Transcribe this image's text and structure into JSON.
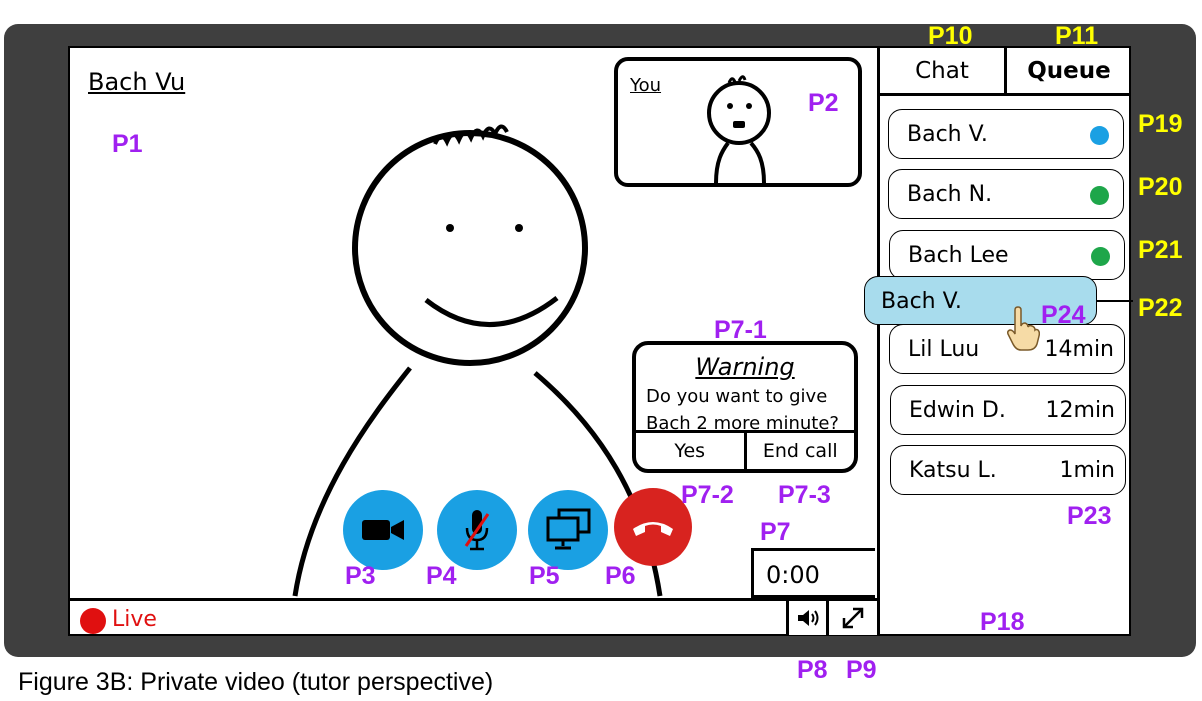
{
  "figure_caption": "Figure 3B: Private video (tutor perspective)",
  "video": {
    "tutor_name": "Bach Vu",
    "self_view_label": "You",
    "timer": "0:00",
    "live_label": "Live"
  },
  "controls": {
    "camera": "video-camera-icon",
    "microphone": "muted-microphone-icon",
    "screen_share": "screen-share-icon",
    "end_call": "hang-up-icon",
    "volume": "speaker-icon",
    "fullscreen": "expand-icon"
  },
  "warning_dialog": {
    "title": "Warning",
    "message": "Do you want to give Bach 2 more minute?",
    "yes_label": "Yes",
    "end_call_label": "End call"
  },
  "sidebar": {
    "tabs": [
      {
        "label": "Chat",
        "active": false
      },
      {
        "label": "Queue",
        "active": true
      }
    ],
    "queue": [
      {
        "name": "Bach V.",
        "status_color": "#1aa0e3"
      },
      {
        "name": "Bach N.",
        "status_color": "#1ea64a"
      },
      {
        "name": "Bach Lee",
        "status_color": "#1ea64a"
      },
      {
        "name": "Lil Luu",
        "wait": "14min"
      },
      {
        "name": "Edwin D.",
        "wait": "12min"
      },
      {
        "name": "Katsu L.",
        "wait": "1min"
      }
    ],
    "dragging_item": "Bach V."
  },
  "annotations": {
    "p1": "P1",
    "p2": "P2",
    "p3": "P3",
    "p4": "P4",
    "p5": "P5",
    "p6": "P6",
    "p7": "P7",
    "p7_1": "P7-1",
    "p7_2": "P7-2",
    "p7_3": "P7-3",
    "p8": "P8",
    "p9": "P9",
    "p10": "P10",
    "p11": "P11",
    "p18": "P18",
    "p19": "P19",
    "p20": "P20",
    "p21": "P21",
    "p22": "P22",
    "p23": "P23",
    "p24": "P24"
  },
  "colors": {
    "frame": "#3f3f3f",
    "button_blue": "#1aa0e3",
    "button_red": "#d8231f",
    "live_red": "#e01010",
    "annotation_purple": "#a020f0",
    "annotation_yellow": "#ffff00",
    "drag_highlight": "#a8dced"
  }
}
